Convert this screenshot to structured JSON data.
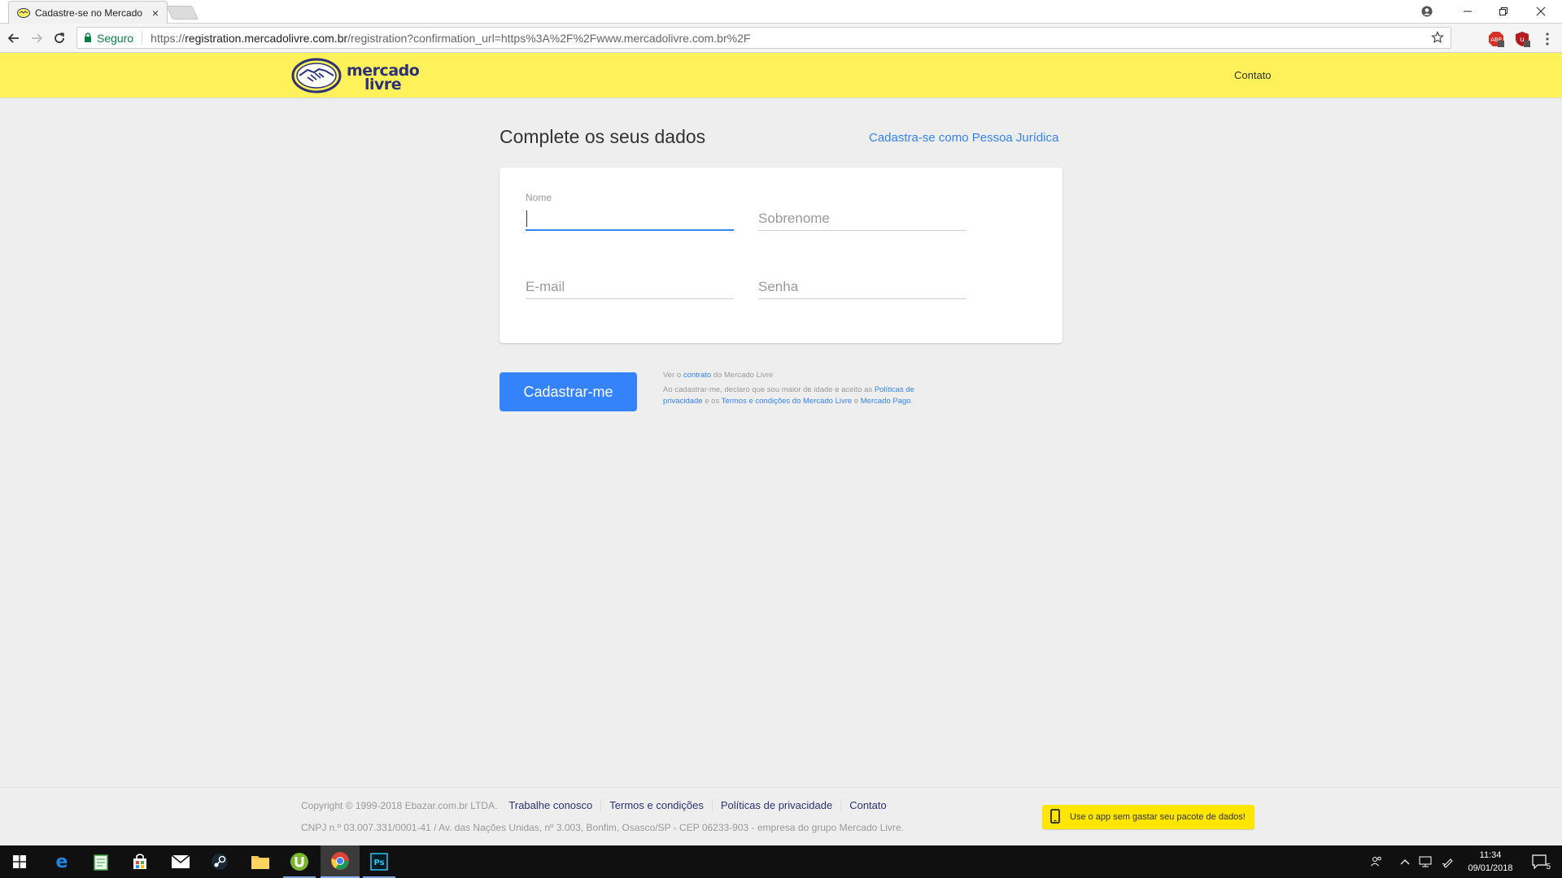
{
  "browser": {
    "tab_title": "Cadastre-se no Mercado",
    "tab_close": "×",
    "security_label": "Seguro",
    "url_scheme": "https://",
    "url_host": "registration.mercadolivre.com.br",
    "url_path": "/registration?confirmation_url=https%3A%2F%2Fwww.mercadolivre.com.br%2F"
  },
  "header": {
    "logo_line1": "mercado",
    "logo_line2": "livre",
    "contact_label": "Contato"
  },
  "main": {
    "title": "Complete os seus dados",
    "pj_link": "Cadastra-se como Pessoa Jurídica",
    "fields": {
      "nome": {
        "label": "Nome",
        "value": ""
      },
      "sobrenome": {
        "placeholder": "Sobrenome"
      },
      "email": {
        "placeholder": "E-mail"
      },
      "senha": {
        "placeholder": "Senha"
      }
    },
    "submit_label": "Cadastrar-me",
    "legal": {
      "line1_pre": "Ver o ",
      "line1_link": "contrato",
      "line1_post": " do Mercado Livre",
      "line2_pre": "Ao cadastrar-me, declaro que sou maior de idade e aceito as ",
      "link_privacy": "Políticas de privacidade",
      "line2_mid": " e os ",
      "link_terms": "Termos e condições do Mercado Livre",
      "line2_and": " e ",
      "link_mp": "Mercado Pago",
      "line2_end": "."
    }
  },
  "footer": {
    "copyright": "Copyright © 1999-2018 Ebazar.com.br LTDA.",
    "links": [
      "Trabalhe conosco",
      "Termos e condições",
      "Políticas de privacidade",
      "Contato"
    ],
    "cnpj": "CNPJ n.º 03.007.331/0001-41 / Av. das Nações Unidas, nº 3.003, Bonfim, Osasco/SP - CEP 06233-903 - empresa do grupo Mercado Livre.",
    "app_badge": "Use o app sem gastar seu pacote de dados!"
  },
  "taskbar": {
    "time": "11:34",
    "date": "09/01/2018",
    "notification_count": "5",
    "apps": [
      "start-icon",
      "edge-icon",
      "notepad-icon",
      "store-icon",
      "mail-icon",
      "steam-icon",
      "file-explorer-icon",
      "utorrent-icon",
      "chrome-icon",
      "photoshop-icon"
    ]
  },
  "colors": {
    "brand_yellow": "#fff159",
    "brand_navy": "#2d3277",
    "accent_blue": "#3483fa",
    "background": "#eeeeee"
  }
}
